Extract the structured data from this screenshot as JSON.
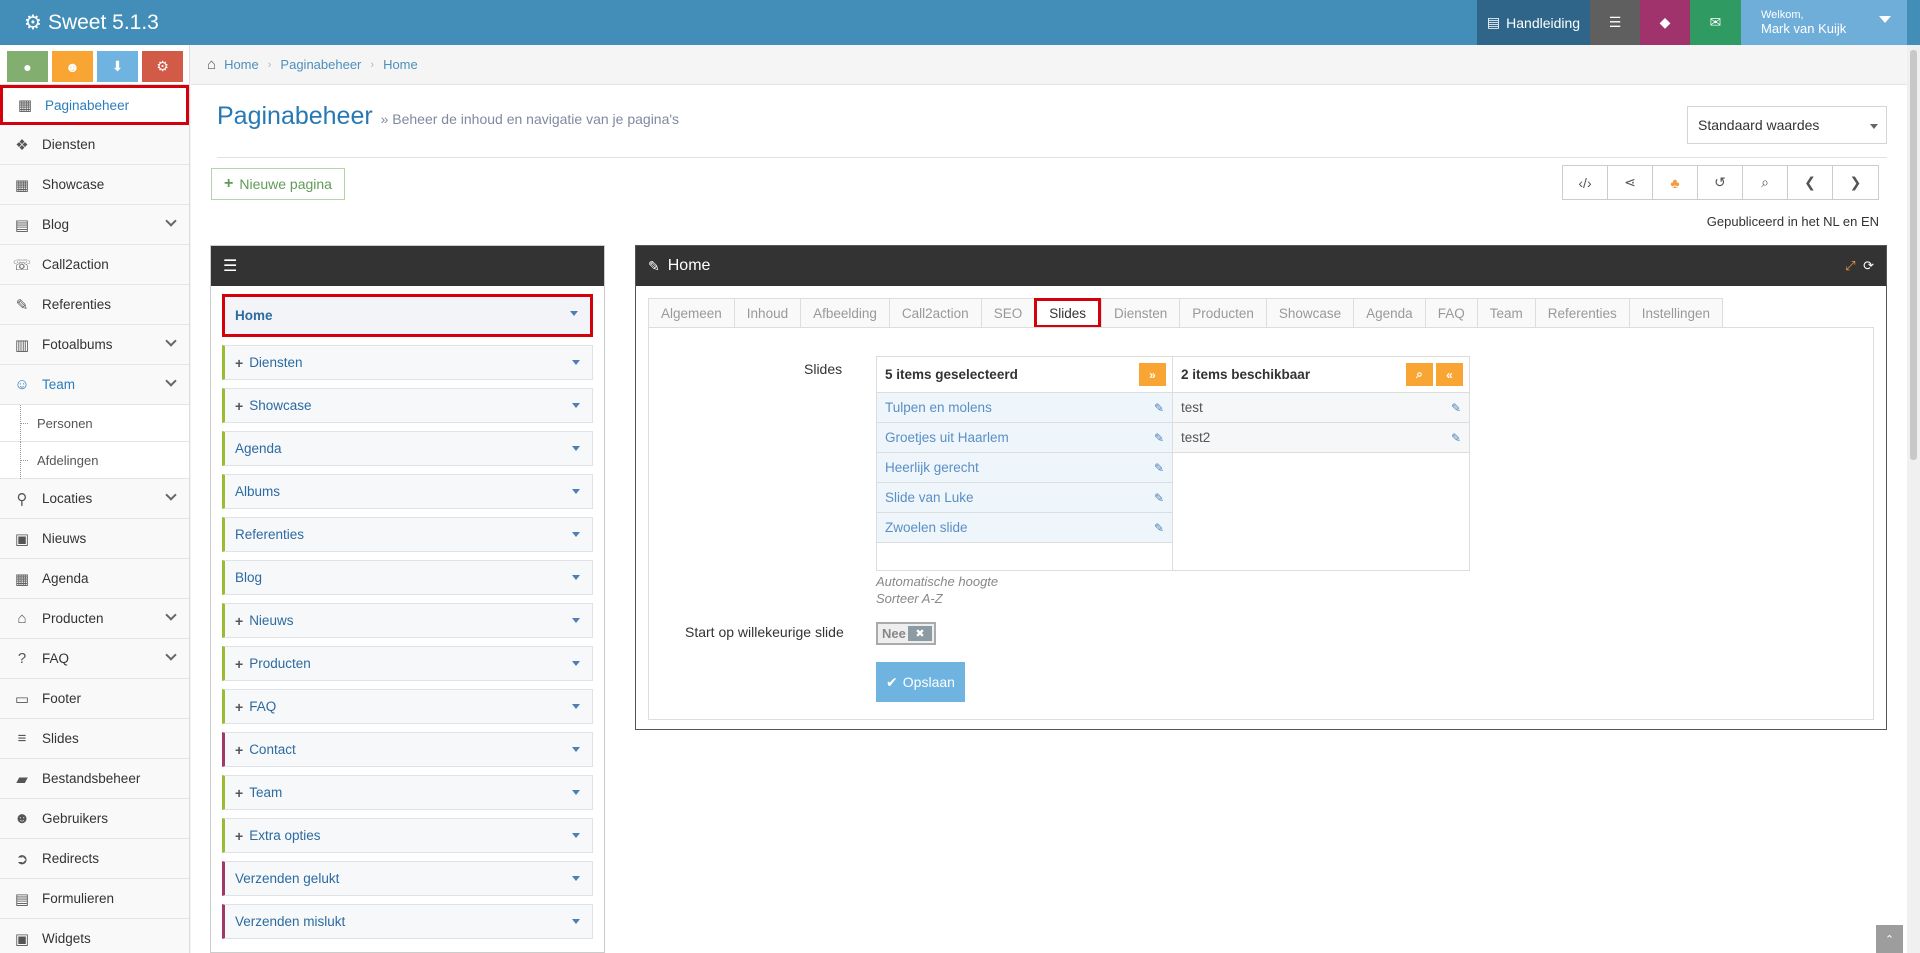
{
  "app": {
    "title": "Sweet 5.1.3"
  },
  "topbar": {
    "manual_label": "Handleiding",
    "welcome": "Welkom,",
    "user_name": "Mark van Kuijk"
  },
  "sidebar": {
    "items": [
      {
        "label": "Paginabeheer",
        "icon": "table-icon"
      },
      {
        "label": "Diensten",
        "icon": "cubes-icon"
      },
      {
        "label": "Showcase",
        "icon": "grid-icon"
      },
      {
        "label": "Blog",
        "icon": "file-icon"
      },
      {
        "label": "Call2action",
        "icon": "phone-icon"
      },
      {
        "label": "Referenties",
        "icon": "comments-icon"
      },
      {
        "label": "Fotoalbums",
        "icon": "book-icon"
      },
      {
        "label": "Team",
        "icon": "users-icon"
      },
      {
        "label": "Personen"
      },
      {
        "label": "Afdelingen"
      },
      {
        "label": "Locaties",
        "icon": "map-marker-icon"
      },
      {
        "label": "Nieuws",
        "icon": "newspaper-icon"
      },
      {
        "label": "Agenda",
        "icon": "calendar-icon"
      },
      {
        "label": "Producten",
        "icon": "tags-icon"
      },
      {
        "label": "FAQ",
        "icon": "question-icon"
      },
      {
        "label": "Footer",
        "icon": "list-icon"
      },
      {
        "label": "Slides",
        "icon": "sliders-icon"
      },
      {
        "label": "Bestandsbeheer",
        "icon": "folder-icon"
      },
      {
        "label": "Gebruikers",
        "icon": "user-icon"
      },
      {
        "label": "Redirects",
        "icon": "redirect-icon"
      },
      {
        "label": "Formulieren",
        "icon": "form-icon"
      },
      {
        "label": "Widgets",
        "icon": "widget-icon"
      }
    ]
  },
  "breadcrumb": [
    "Home",
    "Paginabeheer",
    "Home"
  ],
  "page": {
    "title": "Paginabeheer",
    "subtitle": "» Beheer de inhoud en navigatie van je pagina's",
    "select_value": "Standaard waardes",
    "new_page_label": "Nieuwe pagina",
    "published": "Gepubliceerd in het NL en EN"
  },
  "tree": {
    "items": [
      {
        "label": "Home"
      },
      {
        "label": "Diensten"
      },
      {
        "label": "Showcase"
      },
      {
        "label": "Agenda"
      },
      {
        "label": "Albums"
      },
      {
        "label": "Referenties"
      },
      {
        "label": "Blog"
      },
      {
        "label": "Nieuws"
      },
      {
        "label": "Producten"
      },
      {
        "label": "FAQ"
      },
      {
        "label": "Contact"
      },
      {
        "label": "Team"
      },
      {
        "label": "Extra opties"
      },
      {
        "label": "Verzenden gelukt"
      },
      {
        "label": "Verzenden mislukt"
      }
    ]
  },
  "editor": {
    "title": "Home",
    "tabs": [
      "Algemeen",
      "Inhoud",
      "Afbeelding",
      "Call2action",
      "SEO",
      "Slides",
      "Diensten",
      "Producten",
      "Showcase",
      "Agenda",
      "FAQ",
      "Team",
      "Referenties",
      "Instellingen"
    ],
    "active_tab": "Slides",
    "slides_label": "Slides",
    "selected_header": "5 items geselecteerd",
    "available_header": "2 items beschikbaar",
    "selected": [
      "Tulpen en molens",
      "Groetjes uit Haarlem",
      "Heerlijk gerecht",
      "Slide van Luke",
      "Zwoelen slide"
    ],
    "available": [
      "test",
      "test2"
    ],
    "hint_height": "Automatische hoogte",
    "hint_sort": "Sorteer A-Z",
    "random_label": "Start op willekeurige slide",
    "toggle_value": "Nee",
    "save_label": "Opslaan"
  },
  "colors": {
    "topbar": "#438eb9",
    "highlight": "#d4000b",
    "accent": "#2679b5"
  }
}
